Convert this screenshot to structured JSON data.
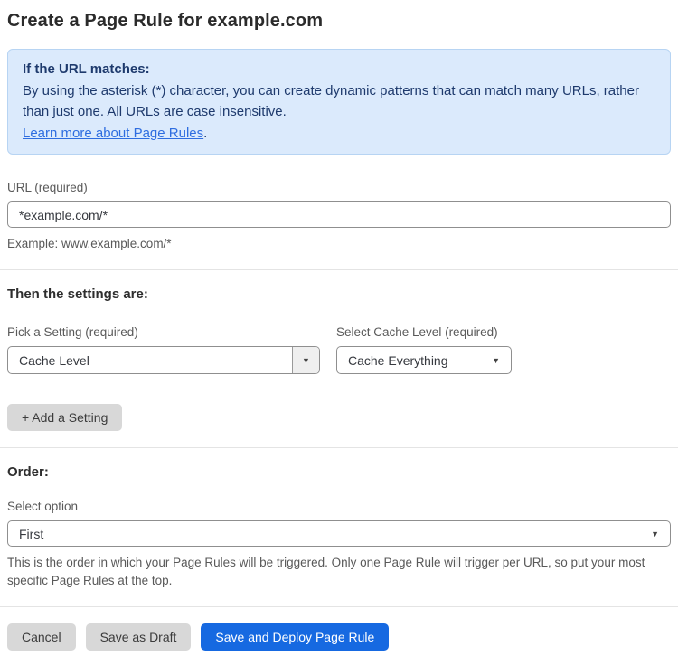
{
  "page": {
    "title": "Create a Page Rule for example.com"
  },
  "info_box": {
    "heading": "If the URL matches:",
    "body": "By using the asterisk (*) character, you can create dynamic patterns that can match many URLs, rather than just one. All URLs are case insensitive.",
    "link_label": "Learn more about Page Rules",
    "link_suffix": "."
  },
  "url_field": {
    "label": "URL (required)",
    "value": "*example.com/*",
    "helper": "Example: www.example.com/*"
  },
  "settings_section": {
    "heading": "Then the settings are:",
    "setting_picker": {
      "label": "Pick a Setting (required)",
      "value": "Cache Level"
    },
    "cache_level_picker": {
      "label": "Select Cache Level (required)",
      "value": "Cache Everything"
    },
    "add_setting_label": "+ Add a Setting"
  },
  "order_section": {
    "heading": "Order:",
    "select_label": "Select option",
    "value": "First",
    "helper": "This is the order in which your Page Rules will be triggered. Only one Page Rule will trigger per URL, so put your most specific Page Rules at the top."
  },
  "actions": {
    "cancel_label": "Cancel",
    "save_draft_label": "Save as Draft",
    "save_deploy_label": "Save and Deploy Page Rule"
  },
  "icons": {
    "dropdown_arrow": "▼"
  },
  "colors": {
    "info_bg": "#dbeafc",
    "info_border": "#b7d4f3",
    "info_text": "#1e3a6d",
    "link_blue": "#2e6de0",
    "primary_button_blue": "#1669e1",
    "secondary_button_gray": "#d8d8d8"
  }
}
